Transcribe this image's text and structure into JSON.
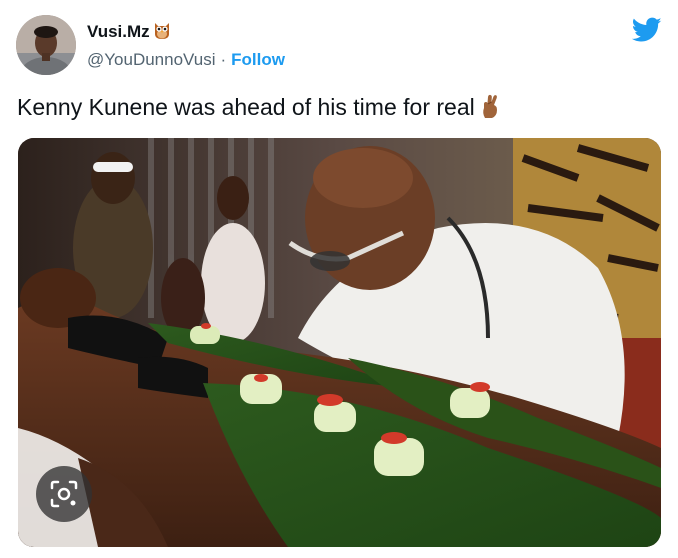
{
  "tweet": {
    "author": {
      "display_name": "Vusi.Mz",
      "name_emoji": "owl-emoji",
      "handle": "@YouDunnoVusi",
      "separator": "·",
      "follow_label": "Follow"
    },
    "text": "Kenny Kunene was ahead of his time for real",
    "text_emoji": "crossed-fingers-emoji",
    "brand_icon": "twitter-bird-icon",
    "media": {
      "description_icon": "photo",
      "overlay_icon": "lens-search-icon"
    }
  },
  "colors": {
    "text_primary": "#0f1419",
    "text_secondary": "#536471",
    "accent": "#1d9bf0"
  }
}
